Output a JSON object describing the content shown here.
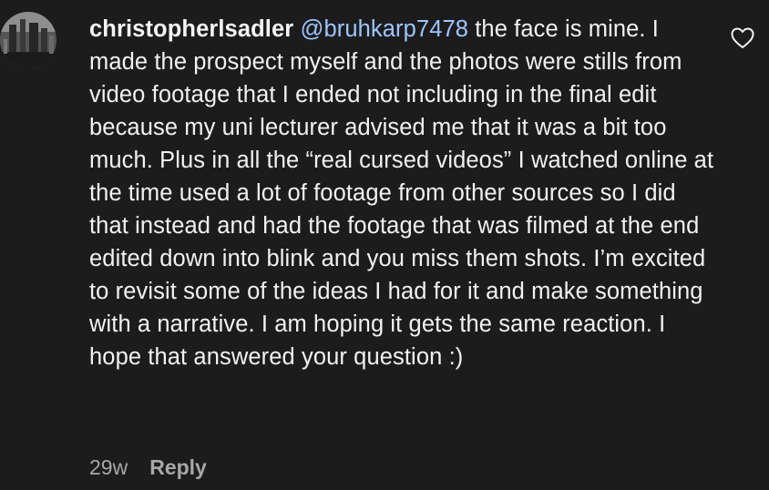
{
  "comment": {
    "username": "christopherlsadler",
    "mention": "@bruhkarp7478",
    "text": "the face is mine. I made the prospect myself and the photos were stills from video footage that I ended not including in the final edit because my uni lecturer advised me that it was a bit too much. Plus in all the “real cursed videos” I watched online at the time used a lot of footage from other sources so I did that instead and had the footage that was filmed at the end edited down into blink and you miss them shots. I’m excited to revisit some of the ideas I had for it and make something with a narrative. I am hoping it gets the same reaction. I hope that answered your question :)",
    "time": "29w",
    "reply_label": "Reply",
    "like_icon": "heart-outline-icon"
  },
  "colors": {
    "background": "#1c1c1d",
    "mention": "#9fc5ff",
    "meta": "#a8a8a8"
  }
}
